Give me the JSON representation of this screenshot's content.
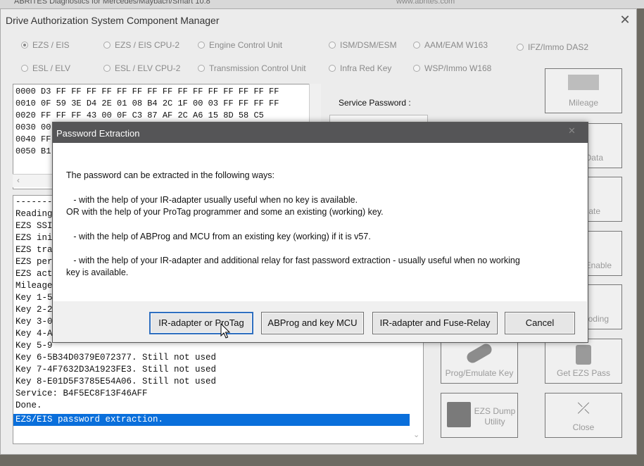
{
  "app_title": "ABRITES Diagnostics for Mercedes/Maybach/Smart 10.8",
  "app_url": "www.abrites.com",
  "window": {
    "title": "Drive Authorization System Component Manager",
    "close": "✕"
  },
  "modules_row1": [
    {
      "label": "EZS / EIS",
      "selected": true
    },
    {
      "label": "EZS / EIS CPU-2",
      "selected": false
    },
    {
      "label": "Engine Control Unit",
      "selected": false
    },
    {
      "label": "ISM/DSM/ESM",
      "selected": false
    },
    {
      "label": "AAM/EAM W163",
      "selected": false
    },
    {
      "label": "IFZ/Immo DAS2",
      "selected": false
    }
  ],
  "modules_row2": [
    {
      "label": "ESL / ELV",
      "selected": false
    },
    {
      "label": "ESL / ELV CPU-2",
      "selected": false
    },
    {
      "label": "Transmission Control Unit",
      "selected": false
    },
    {
      "label": "Infra Red Key",
      "selected": false
    },
    {
      "label": "WSP/Immo W168",
      "selected": false
    }
  ],
  "hex_lines": [
    "0000 D3 FF FF FF FF FF FF FF FF FF FF FF FF FF FF FF",
    "0010 0F 59 3E D4 2E 01 08 B4 2C 1F 00 03 FF FF FF FF",
    "0020 FF FF FF 43 00 0F C3 87 AF 2C A6 15 8D 58 C5",
    "0030 00",
    "0040 FF",
    "0050 B1"
  ],
  "service_password_label": "Service Password :",
  "log_lines": [
    "--------",
    "Reading",
    "EZS SSI",
    "EZS ini",
    "EZS tra",
    "EZS per",
    "EZS act",
    "Mileage",
    "Key 1-5",
    "Key 2-2",
    "Key 3-0",
    "Key 4-A",
    "Key 5-9",
    "Key 6-5B34D0379E072377. Still not used",
    "Key 7-4F7632D3A1923FE3. Still not used",
    "Key 8-E01D5F3785E54A06. Still not used",
    "Service: B4F5EC8F13F46AFF",
    "Done.",
    "EZS/EIS password extraction."
  ],
  "right_buttons": [
    {
      "label": "Mileage",
      "icon": "mileage-icon"
    },
    {
      "label": "Data",
      "icon": "data-icon"
    },
    {
      "label": "ate",
      "icon": "activate-icon"
    },
    {
      "label": "Enable",
      "icon": "enable-icon"
    },
    {
      "label": "oding",
      "icon": "coding-icon"
    },
    {
      "label": "Prog/Emulate Key",
      "icon": "key-icon"
    },
    {
      "label": "Get EZS Pass",
      "icon": "ezs-pass-icon"
    },
    {
      "label": "EZS Dump Utility",
      "icon": "chip-icon"
    },
    {
      "label": "Close",
      "icon": "close-icon"
    }
  ],
  "dialog": {
    "title": "Password Extraction",
    "close": "✕",
    "lines": [
      "The password can be extracted in the following ways:",
      "   - with the help of your IR-adapter usually useful when no key is available.",
      "OR with the help of your ProTag programmer and some an existing (working) key.",
      "   - with the help of ABProg and MCU from an existing key (working) if it is v57.",
      "   - with the help of your IR-adapter and additional relay for fast password extraction - usually useful when no working",
      "key is available."
    ],
    "buttons": {
      "ir_protag": "IR-adapter or ProTag",
      "abprog": "ABProg and key MCU",
      "ir_fuse": "IR-adapter and Fuse-Relay",
      "cancel": "Cancel"
    }
  },
  "colors": {
    "selection": "#0a6fdb",
    "dialog_title_bg": "#555557",
    "focus_border": "#2f6fc0"
  }
}
